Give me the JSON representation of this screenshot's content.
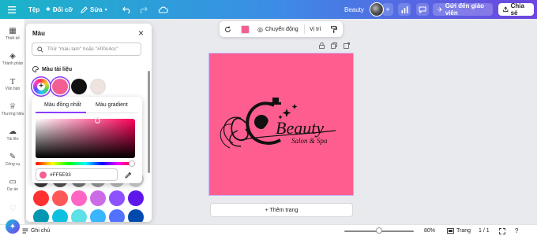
{
  "topbar": {
    "menu_icon": "hamburger-icon",
    "file_label": "Tệp",
    "resize_label": "Đổi cỡ",
    "edit_label": "Sửa",
    "edit_icon": "pen-icon",
    "undo_icon": "undo-icon",
    "redo_icon": "redo-icon",
    "cloud_icon": "cloud-icon",
    "design_title": "Beauty",
    "share_label": "Chia sẻ",
    "send_label": "Gửi đến giáo viên",
    "gradient_colors": [
      "#1ab4c8",
      "#3b8ee6",
      "#6d45e0"
    ]
  },
  "rail": {
    "items": [
      {
        "label": "Thiết kế",
        "icon": "layout-icon"
      },
      {
        "label": "Thành phần",
        "icon": "elements-icon"
      },
      {
        "label": "Văn bản",
        "icon": "text-icon"
      },
      {
        "label": "Thương hiệu",
        "icon": "brand-icon"
      },
      {
        "label": "Tải lên",
        "icon": "upload-icon"
      },
      {
        "label": "Công cụ",
        "icon": "tools-icon"
      },
      {
        "label": "Dự án",
        "icon": "folder-icon"
      }
    ]
  },
  "panel": {
    "title": "Màu",
    "search_placeholder": "Thử \"màu lam\" hoặc \"#00c4cc\"",
    "doc_colors_title": "Màu tài liệu",
    "doc_colors": [
      "#f35e93",
      "#111111",
      "#eee3de"
    ],
    "grid_colors": [
      [
        "#3a3a3a",
        "#555555",
        "#777777",
        "#999999",
        "#bbbbbb",
        "#d0d0d0"
      ],
      [
        "#ff3131",
        "#ff5757",
        "#ff66c4",
        "#cb6ce6",
        "#8c52ff",
        "#5e17eb"
      ],
      [
        "#0097b2",
        "#0cc0df",
        "#5ce1e6",
        "#38b6ff",
        "#5271ff",
        "#004aad"
      ]
    ]
  },
  "picker": {
    "tab_solid": "Màu đồng nhất",
    "tab_gradient": "Màu gradient",
    "hex_value": "#FF5E93",
    "current_color": "#f35e93"
  },
  "ctx_toolbar": {
    "animate_label": "Chuyển động",
    "position_label": "Vị trí",
    "fill_color": "#f35e93"
  },
  "canvas": {
    "page_color": "#fd5e8f",
    "logo_title": "Beauty",
    "logo_subtitle": "Salon & Spa",
    "add_page_label": "+ Thêm trang"
  },
  "bottombar": {
    "notes_label": "Ghi chú",
    "zoom_percent": "80%",
    "zoom_value": 0.5,
    "pages_label": "Trang",
    "page_count": "1 / 1"
  }
}
